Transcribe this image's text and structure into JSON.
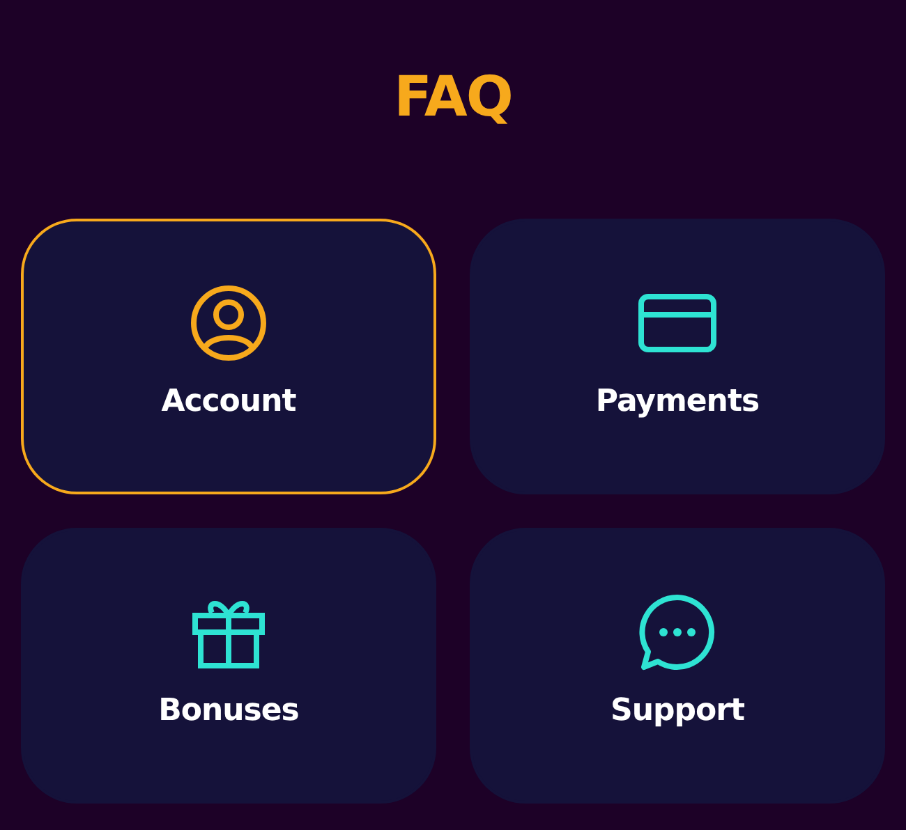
{
  "title": "FAQ",
  "categories": [
    {
      "label": "Account",
      "kind": "user",
      "selected": true
    },
    {
      "label": "Payments",
      "kind": "card",
      "selected": false
    },
    {
      "label": "Bonuses",
      "kind": "gift",
      "selected": false
    },
    {
      "label": "Support",
      "kind": "chat",
      "selected": false
    }
  ]
}
